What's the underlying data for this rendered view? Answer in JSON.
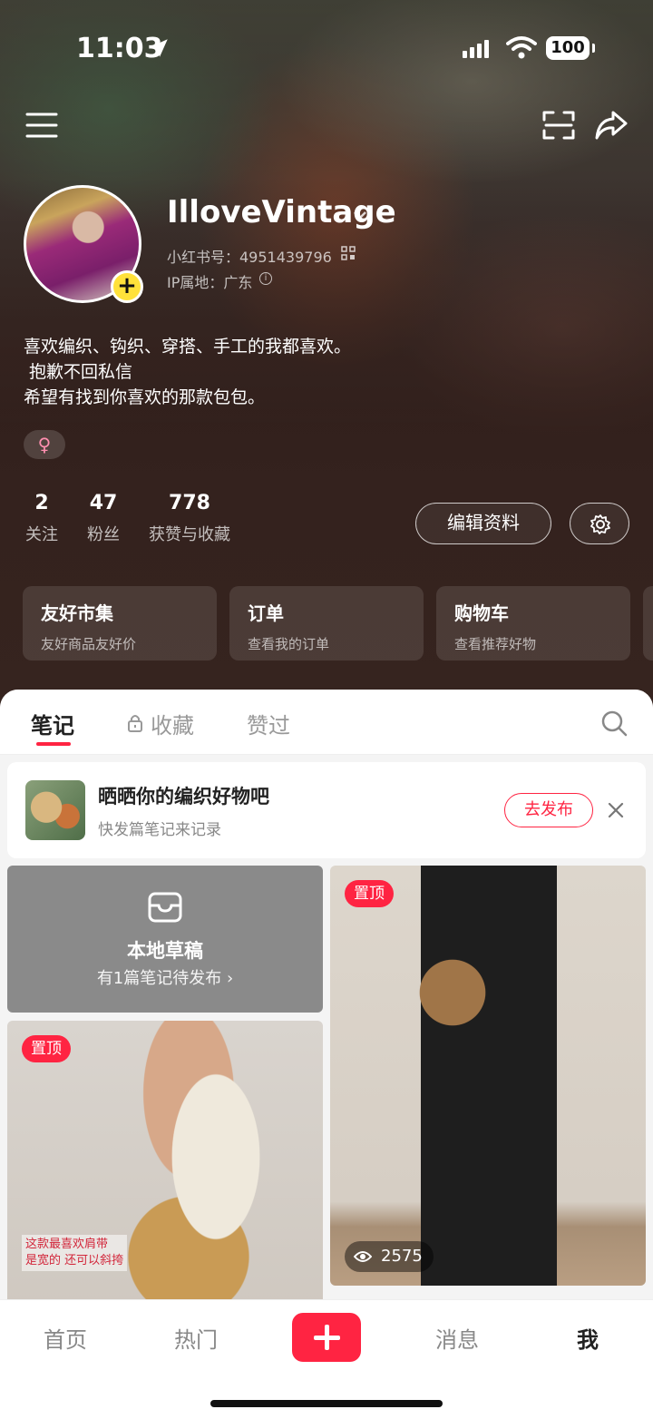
{
  "status_bar": {
    "time": "11:03",
    "battery": "100"
  },
  "profile": {
    "username": "IlloveVintage",
    "user_id": "小红书号：4951439796",
    "ip": "IP属地：广东",
    "bio": "喜欢编织、钩织、穿搭、手工的我都喜欢。\n 抱歉不回私信\n希望有找到你喜欢的那款包包。",
    "gender_symbol": "♀",
    "stats": [
      {
        "value": "2",
        "label": "关注"
      },
      {
        "value": "47",
        "label": "粉丝"
      },
      {
        "value": "778",
        "label": "获赞与收藏"
      }
    ],
    "edit_label": "编辑资料"
  },
  "service_cards": [
    {
      "title": "友好市集",
      "subtitle": "友好商品友好价"
    },
    {
      "title": "订单",
      "subtitle": "查看我的订单"
    },
    {
      "title": "购物车",
      "subtitle": "查看推荐好物"
    }
  ],
  "tabs": {
    "notes": "笔记",
    "collections": "收藏",
    "liked": "赞过"
  },
  "promo": {
    "title": "晒晒你的编织好物吧",
    "subtitle": "快发篇笔记来记录",
    "button": "去发布"
  },
  "draft": {
    "title": "本地草稿",
    "subtitle": "有1篇笔记待发布 ›"
  },
  "posts": {
    "left": {
      "badge": "置顶",
      "caption": "这款最喜欢肩带\n是宽的 还可以斜挎"
    },
    "right": {
      "badge": "置顶",
      "views": "2575"
    }
  },
  "bottom_nav": {
    "home": "首页",
    "hot": "热门",
    "messages": "消息",
    "me": "我"
  },
  "colors": {
    "accent": "#ff2442",
    "avatar_badge": "#ffe13a"
  }
}
